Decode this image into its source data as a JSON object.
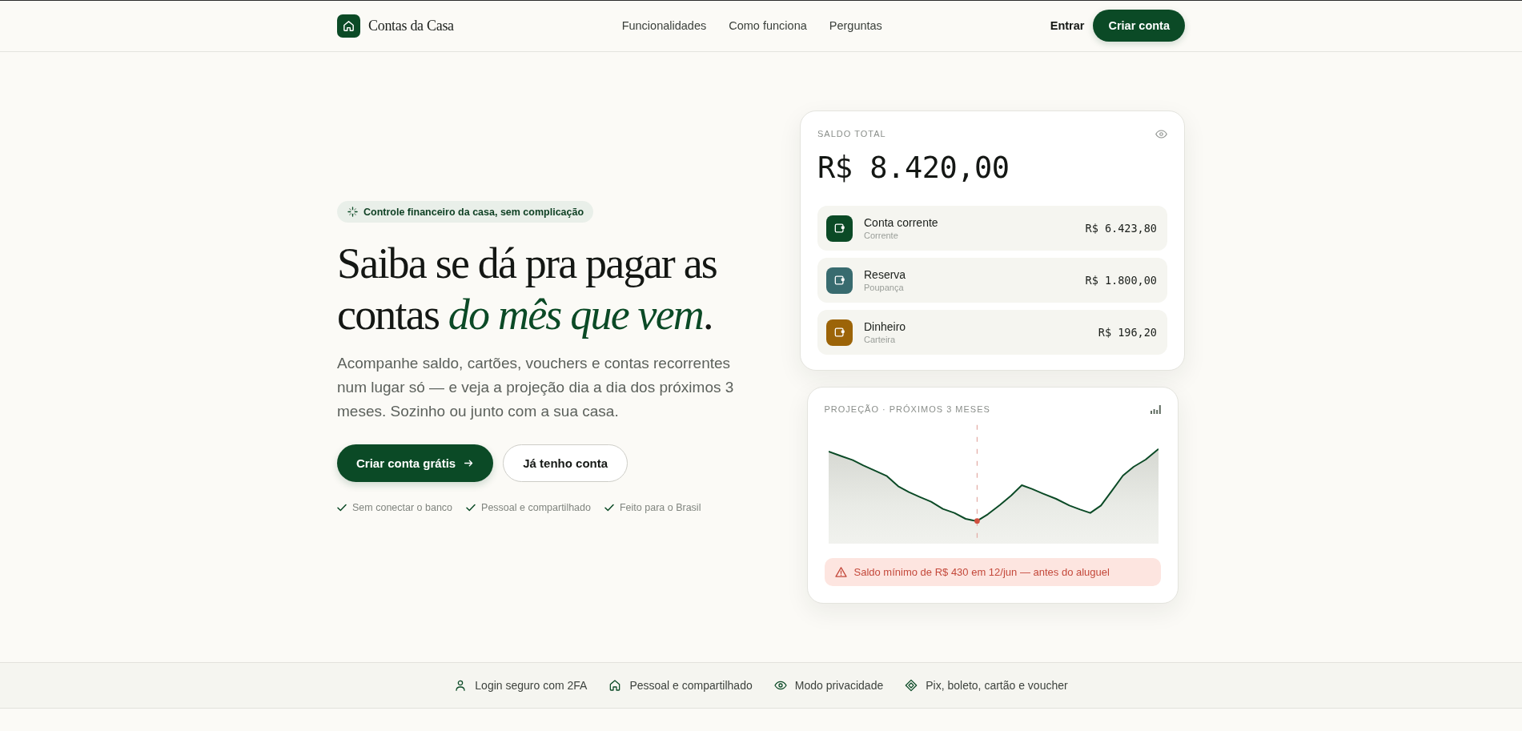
{
  "header": {
    "brand": "Contas da Casa",
    "nav": [
      "Funcionalidades",
      "Como funciona",
      "Perguntas"
    ],
    "login": "Entrar",
    "signup": "Criar conta"
  },
  "hero": {
    "badge": "Controle financeiro da casa, sem complicação",
    "heading": "Saiba se dá pra pagar as contas *do mês que vem*.",
    "description": "Acompanhe saldo, cartões, vouchers e contas recorrentes num lugar só — e veja a projeção dia a dia dos próximos 3 meses. Sozinho ou junto com a sua casa.",
    "buttons": [
      {
        "label": "Criar conta grátis",
        "kind": "primary"
      },
      {
        "label": "Já tenho conta",
        "kind": "secondary"
      }
    ],
    "features": [
      "Sem conectar o banco",
      "Pessoal e compartilhado",
      "Feito para o Brasil"
    ]
  },
  "balance_card": {
    "label": "SALDO TOTAL",
    "amount": "R$ 8.420,00",
    "accounts": [
      {
        "name": "Conta corrente",
        "type": "Corrente",
        "amount": "R$ 6.423,80",
        "color": "#0b4a26"
      },
      {
        "name": "Reserva",
        "type": "Poupança",
        "amount": "R$ 1.800,00",
        "color": "#386b6f"
      },
      {
        "name": "Dinheiro",
        "type": "Carteira",
        "amount": "R$ 196,20",
        "color": "#9c6408"
      }
    ]
  },
  "projection_card": {
    "title": "PROJEÇÃO · PRÓXIMOS 3 MESES",
    "alert": "Saldo mínimo de R$ 430 em 12/jun — antes do aluguel"
  },
  "trust_bar": [
    {
      "label": "Login seguro com 2FA",
      "kind": "user"
    },
    {
      "label": "Pessoal e compartilhado",
      "kind": "home"
    },
    {
      "label": "Modo privacidade",
      "kind": "eye"
    },
    {
      "label": "Pix, boleto, cartão e voucher",
      "kind": "diamond"
    }
  ]
}
